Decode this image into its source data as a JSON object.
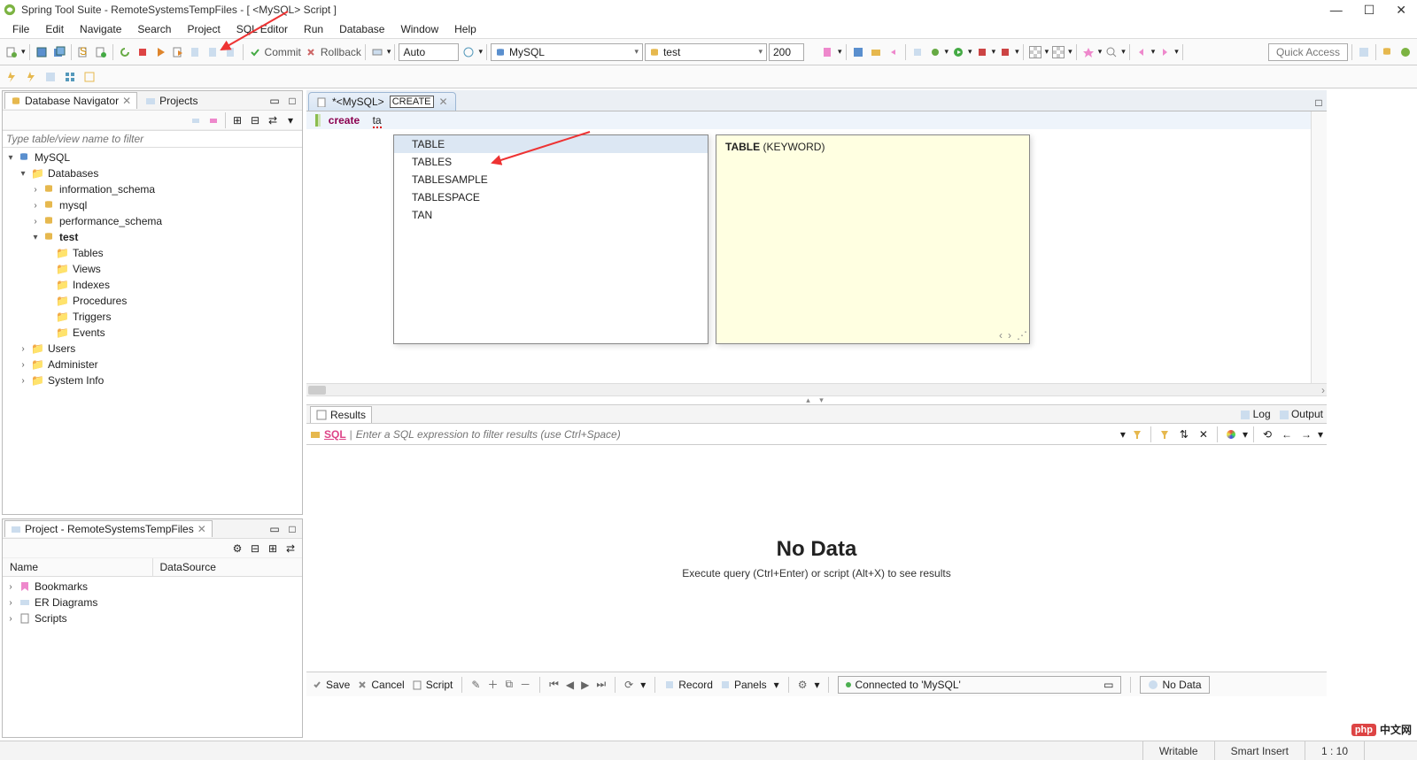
{
  "title": "Spring Tool Suite - RemoteSystemsTempFiles - [ <MySQL> Script ]",
  "menu": [
    "File",
    "Edit",
    "Navigate",
    "Search",
    "Project",
    "SQL Editor",
    "Run",
    "Database",
    "Window",
    "Help"
  ],
  "toolbar": {
    "commit_label": "Commit",
    "rollback_label": "Rollback",
    "auto_label": "Auto",
    "db_type": "MySQL",
    "database": "test",
    "limit": "200",
    "quick_access": "Quick Access"
  },
  "navigator": {
    "tab_db": "Database Navigator",
    "tab_projects": "Projects",
    "filter_placeholder": "Type table/view name to filter",
    "root": "MySQL",
    "databases_label": "Databases",
    "schemas": [
      "information_schema",
      "mysql",
      "performance_schema"
    ],
    "test_label": "test",
    "test_children": [
      "Tables",
      "Views",
      "Indexes",
      "Procedures",
      "Triggers",
      "Events"
    ],
    "users_label": "Users",
    "admin_label": "Administer",
    "sysinfo_label": "System Info"
  },
  "project_view": {
    "title": "Project - RemoteSystemsTempFiles",
    "col_name": "Name",
    "col_ds": "DataSource",
    "items": [
      "Bookmarks",
      "ER Diagrams",
      "Scripts"
    ]
  },
  "editor": {
    "tab_label": "*<MySQL>",
    "hint": "CREATE",
    "code_kw": "create",
    "code_rest": "ta",
    "autocomplete": [
      "TABLE",
      "TABLES",
      "TABLESAMPLE",
      "TABLESPACE",
      "TAN"
    ],
    "doc_kw": "TABLE",
    "doc_typ": "(KEYWORD)"
  },
  "results": {
    "tab_label": "Results",
    "log_label": "Log",
    "output_label": "Output",
    "sql_label": "SQL",
    "filter_placeholder": "Enter a SQL expression to filter results (use Ctrl+Space)",
    "nodata_title": "No Data",
    "nodata_body": "Execute query (Ctrl+Enter) or script (Alt+X) to see results"
  },
  "bottom": {
    "save": "Save",
    "cancel": "Cancel",
    "script": "Script",
    "record": "Record",
    "panels": "Panels",
    "connected": "Connected to 'MySQL'",
    "nodata_btn": "No Data"
  },
  "status": {
    "writable": "Writable",
    "insert": "Smart Insert",
    "pos": "1 : 10"
  },
  "watermark": {
    "badge": "php",
    "text": "中文网"
  }
}
